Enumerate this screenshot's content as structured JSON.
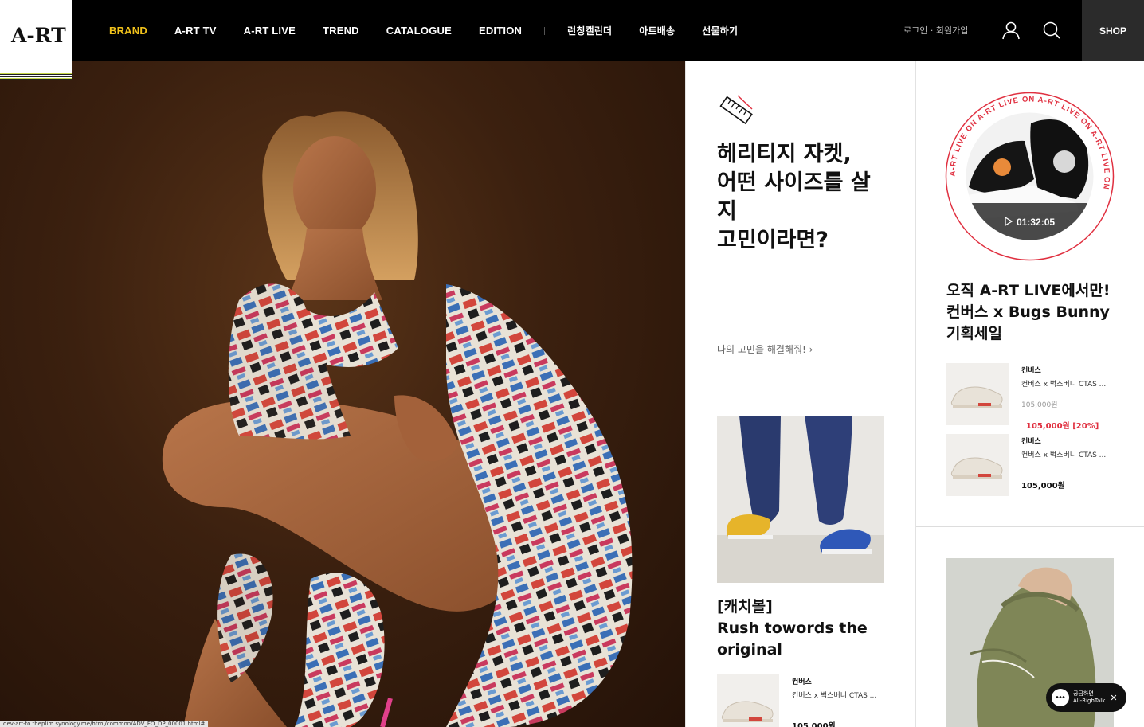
{
  "header": {
    "logo": "A-RT",
    "nav": [
      {
        "label": "BRAND",
        "active": true
      },
      {
        "label": "A-RT TV",
        "active": false
      },
      {
        "label": "A-RT LIVE",
        "active": false
      },
      {
        "label": "TREND",
        "active": false
      },
      {
        "label": "CATALOGUE",
        "active": false
      },
      {
        "label": "EDITION",
        "active": false
      }
    ],
    "nav_kr": [
      "런칭캘린더",
      "아트배송",
      "선물하기"
    ],
    "login": "로그인 · 회원가입",
    "shop": "SHOP",
    "accent_color": "#f1c21b"
  },
  "hero": {
    "status_url": "dev-art-fo.theplim.synology.me/html/common/ADV_FO_DP_00001.html#"
  },
  "heritage": {
    "title_lines": [
      "헤리티지 자켓,",
      "어떤 사이즈를 살",
      "지",
      "고민이라면?"
    ],
    "link": "나의 고민을 해결해줘! ›"
  },
  "catchball": {
    "title_lines": [
      "[캐치볼]",
      "Rush towords the",
      "original"
    ],
    "product": {
      "brand": "컨버스",
      "name": "컨버스 x 벅스버니 CTAS ...",
      "price": "105,000원"
    }
  },
  "live": {
    "ring_text": "A-RT LIVE ON A-RT LIVE ON A-RT LIVE ON A-RT LIVE ON ",
    "timer": "01:32:05",
    "title_lines": [
      "오직 A-RT LIVE에서만!",
      "컨버스 x Bugs Bunny",
      "기획세일"
    ],
    "ring_color": "#e03040",
    "products": [
      {
        "brand": "컨버스",
        "name": "컨버스 x 벅스버니 CTAS ...",
        "old_price": "105,000원",
        "sale": "105,000원 [20%]"
      },
      {
        "brand": "컨버스",
        "name": "컨버스 x 벅스버니 CTAS ...",
        "price": "105,000원"
      }
    ]
  },
  "chat": {
    "line1": "궁금하면",
    "line2": "All-RighTalk",
    "close": "✕"
  }
}
